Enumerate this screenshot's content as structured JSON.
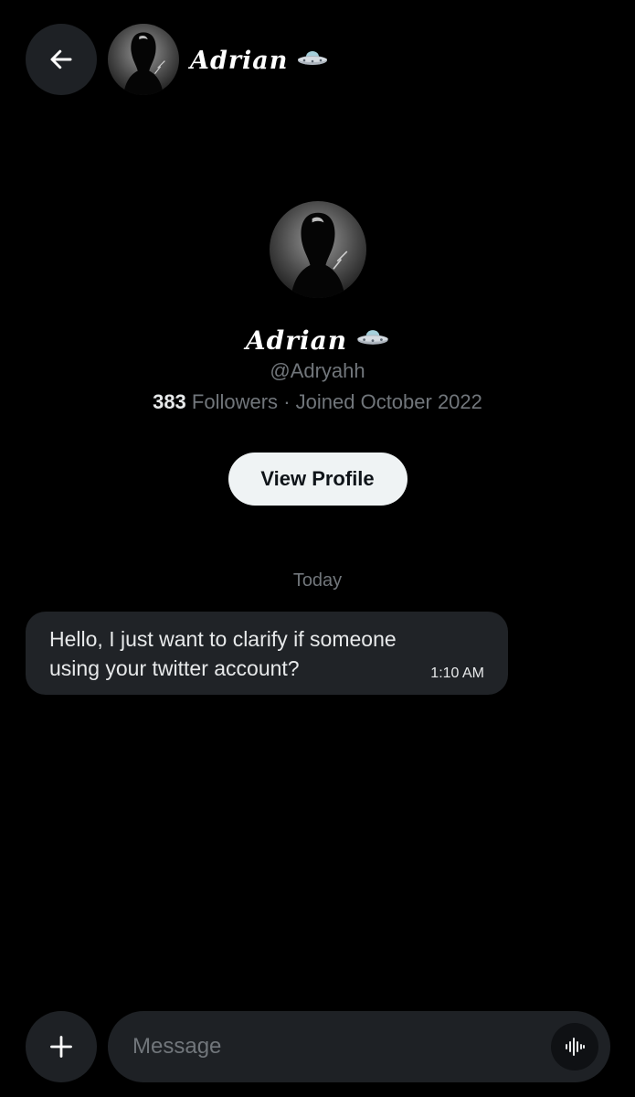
{
  "header": {
    "display_name": "Adrian",
    "name_emoji": "🛸"
  },
  "profile": {
    "display_name": "Adrian",
    "name_emoji": "🛸",
    "handle": "@Adryahh",
    "followers_count": "383",
    "followers_label": "Followers",
    "separator": "·",
    "joined": "Joined October 2022",
    "view_profile_label": "View Profile"
  },
  "conversation": {
    "day_label": "Today",
    "messages": [
      {
        "text": "Hello, I just want to clarify if someone using your twitter account?",
        "time": "1:10 AM"
      }
    ]
  },
  "composer": {
    "placeholder": "Message"
  },
  "icons": {
    "back": "arrow-left-icon",
    "add": "plus-icon",
    "voice": "waveform-icon"
  },
  "colors": {
    "background": "#000000",
    "bubble": "#202327",
    "muted_text": "#71767b",
    "button_bg": "#eff3f4"
  }
}
